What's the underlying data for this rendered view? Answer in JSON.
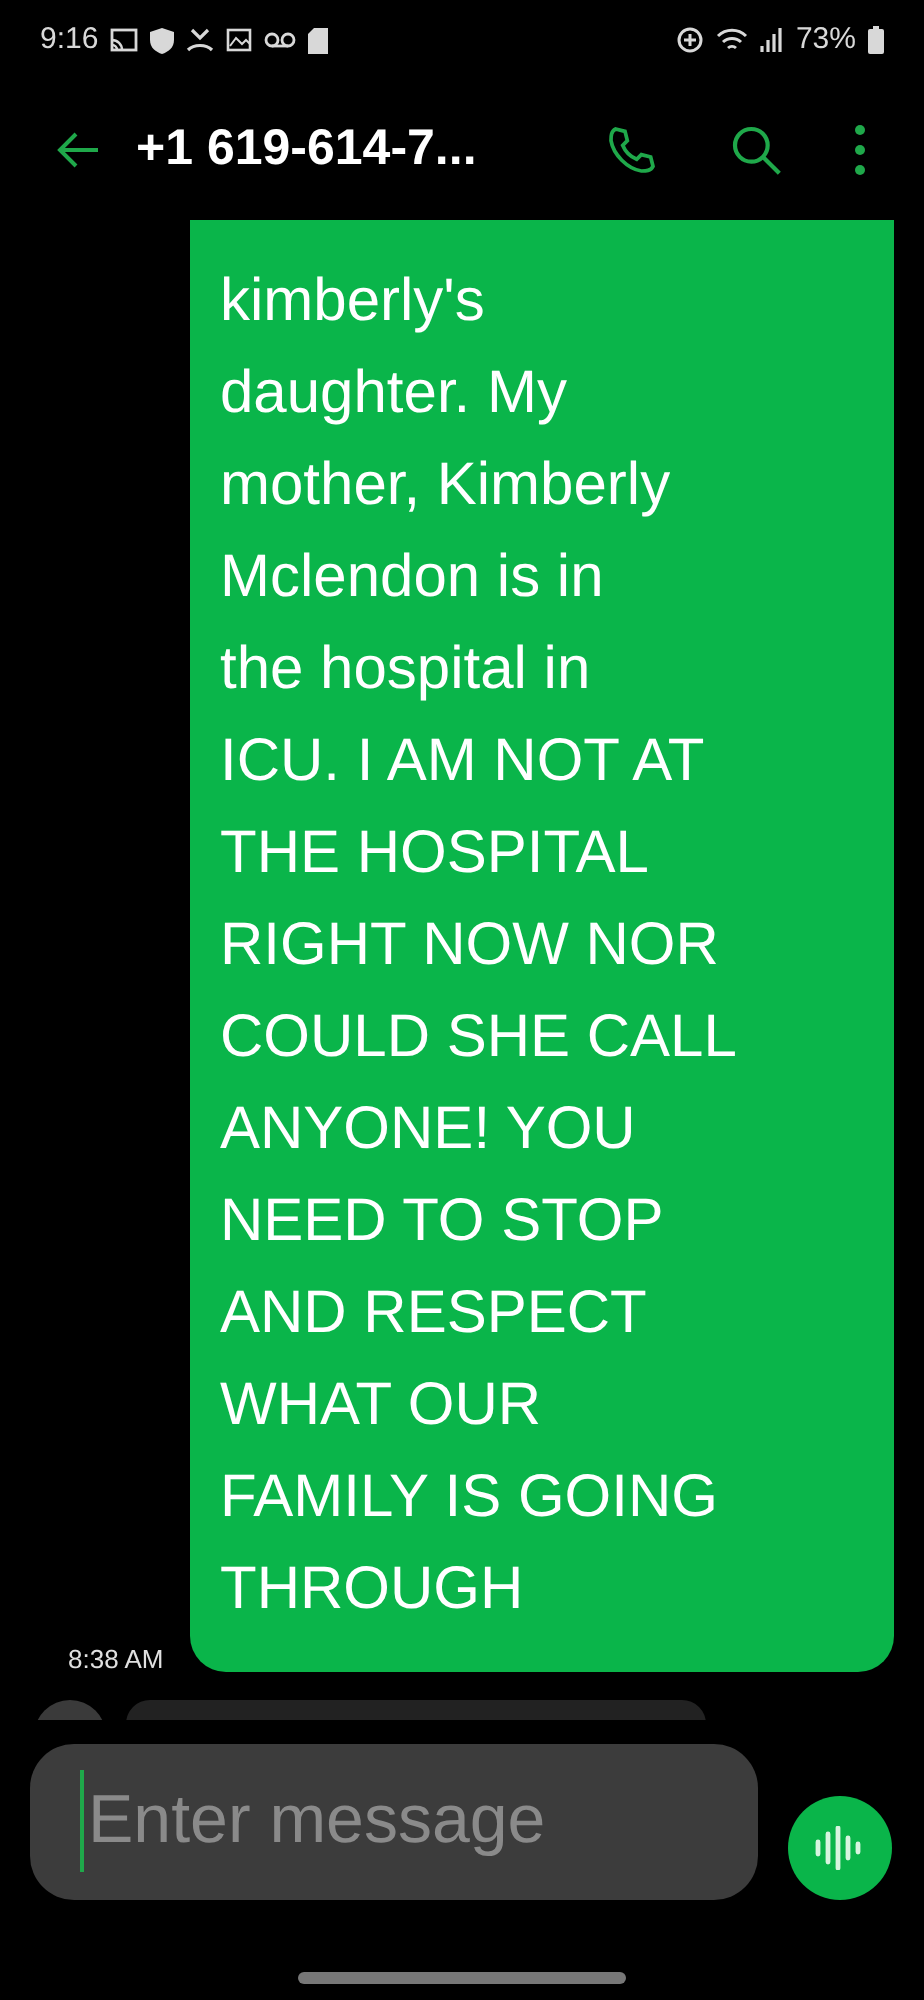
{
  "status_bar": {
    "time": "9:16",
    "battery": "73%"
  },
  "header": {
    "title": "+1 619-614-7..."
  },
  "message": {
    "lines": [
      "kimberly's",
      "daughter. My",
      "mother, Kimberly",
      "Mclendon is in",
      "the hospital in",
      "ICU. I AM NOT AT",
      "THE HOSPITAL",
      "RIGHT NOW NOR",
      "COULD SHE CALL",
      "ANYONE! YOU",
      "NEED TO STOP",
      "AND RESPECT",
      "WHAT OUR",
      "FAMILY IS GOING",
      "THROUGH"
    ],
    "time": "8:38 AM"
  },
  "composer": {
    "placeholder": "Enter message"
  }
}
